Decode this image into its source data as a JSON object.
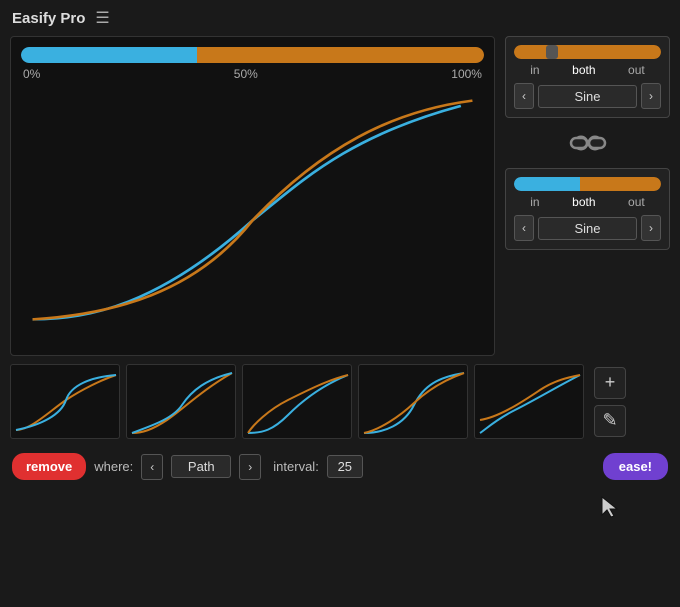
{
  "header": {
    "title": "Easify Pro",
    "menu_icon": "☰"
  },
  "graph": {
    "progress_labels": [
      "0%",
      "50%",
      "100%"
    ],
    "blue_width": "38%",
    "orange_width": "62%"
  },
  "right_panel": {
    "top_section": {
      "tabs": [
        "in",
        "both",
        "out"
      ],
      "active_tab": "both",
      "ease_name": "Sine",
      "prev_label": "‹",
      "next_label": "›"
    },
    "link_icon": "∞",
    "bottom_section": {
      "tabs": [
        "in",
        "both",
        "out"
      ],
      "active_tab": "both",
      "ease_name": "Sine",
      "prev_label": "‹",
      "next_label": "›"
    }
  },
  "presets": [
    {
      "id": 1
    },
    {
      "id": 2
    },
    {
      "id": 3
    },
    {
      "id": 4
    },
    {
      "id": 5
    }
  ],
  "actions": {
    "add_label": "+",
    "edit_label": "✎"
  },
  "bottom_bar": {
    "remove_label": "remove",
    "where_label": "where:",
    "prev_label": "‹",
    "where_value": "Path",
    "next_label": "›",
    "interval_label": "interval:",
    "interval_value": "25",
    "ease_label": "ease!"
  },
  "colors": {
    "blue": "#3ab0e0",
    "orange": "#c8781a",
    "bg": "#111111",
    "panel_bg": "#222222",
    "red": "#e03030",
    "purple": "#7040d0"
  }
}
